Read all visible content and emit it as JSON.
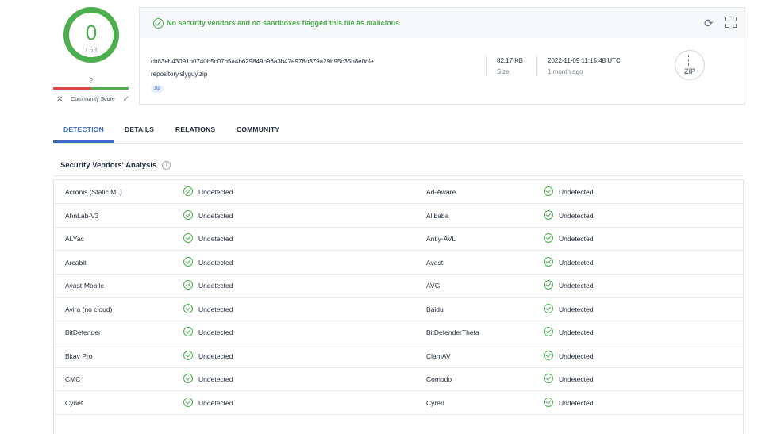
{
  "score": {
    "detections": "0",
    "total": "/ 63",
    "community_value": "?",
    "community_label": "Community Score"
  },
  "banner": {
    "message": "No security vendors and no sandboxes flagged this file as malicious"
  },
  "file": {
    "hash": "cb83eb43091b0740b5c07b5a4b629849b96a3b47e978b379a29b95c35b8e0cfe",
    "name": "repository.slyguy.zip",
    "tag": "zip",
    "size_value": "82.17 KB",
    "size_label": "Size",
    "date_value": "2022-11-09 11:15:48 UTC",
    "date_label": "1 month ago",
    "type_icon_label": "ZIP"
  },
  "tabs": [
    "DETECTION",
    "DETAILS",
    "RELATIONS",
    "COMMUNITY"
  ],
  "section": {
    "title": "Security Vendors' Analysis",
    "info_icon": "i"
  },
  "rows": [
    {
      "vendor1": "Acronis (Static ML)",
      "result1": "Undetected",
      "vendor2": "Ad-Aware",
      "result2": "Undetected"
    },
    {
      "vendor1": "AhnLab-V3",
      "result1": "Undetected",
      "vendor2": "Alibaba",
      "result2": "Undetected"
    },
    {
      "vendor1": "ALYac",
      "result1": "Undetected",
      "vendor2": "Antiy-AVL",
      "result2": "Undetected"
    },
    {
      "vendor1": "Arcabit",
      "result1": "Undetected",
      "vendor2": "Avast",
      "result2": "Undetected"
    },
    {
      "vendor1": "Avast-Mobile",
      "result1": "Undetected",
      "vendor2": "AVG",
      "result2": "Undetected"
    },
    {
      "vendor1": "Avira (no cloud)",
      "result1": "Undetected",
      "vendor2": "Baidu",
      "result2": "Undetected"
    },
    {
      "vendor1": "BitDefender",
      "result1": "Undetected",
      "vendor2": "BitDefenderTheta",
      "result2": "Undetected"
    },
    {
      "vendor1": "Bkav Pro",
      "result1": "Undetected",
      "vendor2": "ClamAV",
      "result2": "Undetected"
    },
    {
      "vendor1": "CMC",
      "result1": "Undetected",
      "vendor2": "Comodo",
      "result2": "Undetected"
    },
    {
      "vendor1": "Cynet",
      "result1": "Undetected",
      "vendor2": "Cyren",
      "result2": "Undetected"
    }
  ],
  "colors": {
    "clean": "#4cae4f",
    "accent": "#3c6dc9",
    "malicious": "#e04848"
  },
  "icons": [
    "check-circle-icon",
    "reload-icon",
    "expand-icon",
    "zip-file-icon",
    "info-icon",
    "close-icon",
    "check-icon"
  ]
}
